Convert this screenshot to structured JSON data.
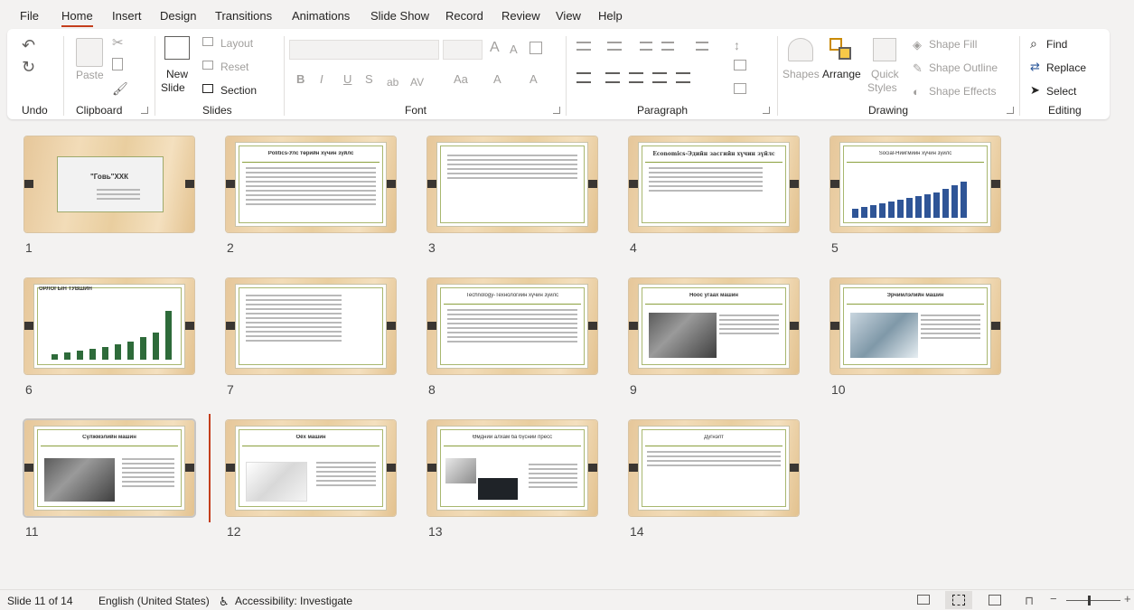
{
  "menu": [
    "File",
    "Home",
    "Insert",
    "Design",
    "Transitions",
    "Animations",
    "Slide Show",
    "Record",
    "Review",
    "View",
    "Help"
  ],
  "ribbon": {
    "undo_group": "Undo",
    "clipboard": {
      "label": "Clipboard",
      "paste": "Paste"
    },
    "slides": {
      "label": "Slides",
      "new_slide_1": "New",
      "new_slide_2": "Slide",
      "layout": "Layout",
      "reset": "Reset",
      "section": "Section"
    },
    "font": {
      "label": "Font",
      "bold": "B",
      "italic": "I",
      "underline": "U",
      "strike": "S",
      "grow": "A",
      "shrink": "A",
      "case": "Aa",
      "font_color": "A",
      "highlight": "A"
    },
    "paragraph": {
      "label": "Paragraph"
    },
    "drawing": {
      "label": "Drawing",
      "shapes": "Shapes",
      "arrange": "Arrange",
      "quick_styles_1": "Quick",
      "quick_styles_2": "Styles",
      "shape_fill": "Shape Fill",
      "shape_outline": "Shape Outline",
      "shape_effects": "Shape Effects"
    },
    "editing": {
      "label": "Editing",
      "find": "Find",
      "replace": "Replace",
      "select": "Select"
    }
  },
  "slides": [
    {
      "n": "1",
      "title": "\"Говь\"ХХК"
    },
    {
      "n": "2",
      "title": "Politics-Улс төрийн хүчин зүйлс"
    },
    {
      "n": "3",
      "title": ""
    },
    {
      "n": "4",
      "title": "Economics-Эдийн засгийн хүчин зүйлс"
    },
    {
      "n": "5",
      "title": "Social-Нийгмийн хүчин зүйлс"
    },
    {
      "n": "6",
      "title": "ОРЛОГЫН ТУВШИН"
    },
    {
      "n": "7",
      "title": ""
    },
    {
      "n": "8",
      "title": "Technology-Технологийн хүчин зүйлс"
    },
    {
      "n": "9",
      "title": "Ноос угаах машин"
    },
    {
      "n": "10",
      "title": "Эрчимлэлийн машин"
    },
    {
      "n": "11",
      "title": "Сүлжмэлийн машин"
    },
    {
      "n": "12",
      "title": "Оёх машин"
    },
    {
      "n": "13",
      "title": "Өмдний алхам ба бүсний пресс"
    },
    {
      "n": "14",
      "title": "Дүгнэлт"
    }
  ],
  "status": {
    "slide_info": "Slide 11 of 14",
    "language": "English (United States)",
    "accessibility": "Accessibility: Investigate"
  },
  "colors": {
    "accent": "#c43e1c",
    "slide_wood": "#ecd3a8",
    "slide_green_rule": "#8ba03e"
  }
}
